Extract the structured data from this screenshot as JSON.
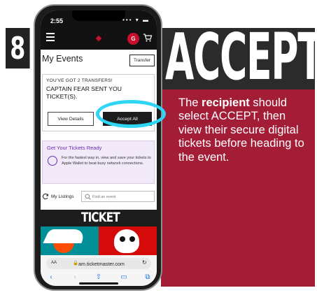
{
  "step": {
    "number": "8",
    "headline": "ACCEPT"
  },
  "instructions": {
    "prefix": "The ",
    "emphasis": "recipient",
    "suffix": " should select ACCEPT, then view their secure digital tickets before heading to the event."
  },
  "status_bar": {
    "time": "2:55",
    "icons": "•••  ▾ ▬"
  },
  "header": {
    "avatar_initial": "G"
  },
  "events": {
    "title": "My Events",
    "transfer_label": "Transfer"
  },
  "transfer_card": {
    "label": "YOU'VE GOT 2 TRANSFERS!",
    "message": "CAPTAIN FEAR SENT YOU TICKET(S).",
    "view_details": "View Details",
    "accept_all": "Accept All"
  },
  "wallet_card": {
    "title": "Get Your Tickets Ready",
    "body": "For the fastest way in, view and save your tickets to Apple Wallet to beat busy network connections."
  },
  "listings": {
    "label": "My Listings",
    "search_placeholder": "Find an event"
  },
  "banner": {
    "word": "TICKET"
  },
  "browser": {
    "aa": "AA",
    "lock": "🔒",
    "url": "am.ticketmaster.com",
    "reload": "↻",
    "nav": [
      "‹",
      "›",
      "⇧",
      "▭",
      "⧉"
    ]
  },
  "colors": {
    "panel_red": "#a41d36",
    "highlight_cyan": "#2fd5f5",
    "brand_red": "#c8102e",
    "wallet_purple": "#6b2fb2"
  }
}
